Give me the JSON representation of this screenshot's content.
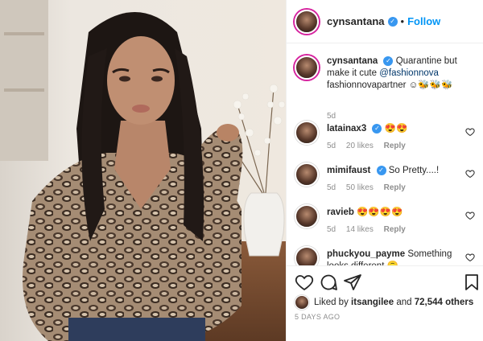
{
  "post": {
    "username": "cynsantana",
    "follow_label": "Follow",
    "separator": "•"
  },
  "caption": {
    "username": "cynsantana",
    "text_before": "Quarantine but make it cute ",
    "mention": "@fashionnova",
    "text_after": " fashionnovapartner ☺🐝🐝🐝",
    "time": "5d"
  },
  "comments": [
    {
      "username": "latainax3",
      "text": "😍😍",
      "time": "5d",
      "likes": "20 likes",
      "reply": "Reply"
    },
    {
      "username": "mimifaust",
      "text": "So Pretty....!",
      "time": "5d",
      "likes": "50 likes",
      "reply": "Reply"
    },
    {
      "username": "ravieb",
      "text": "😍😍😍😍",
      "time": "5d",
      "likes": "14 likes",
      "reply": "Reply"
    },
    {
      "username": "phuckyou_payme",
      "text": "Something looks different 🙃",
      "time": "",
      "likes": "",
      "reply": ""
    }
  ],
  "likes": {
    "prefix": "Liked by",
    "user": "itsangilee",
    "connector": "and",
    "count": "72,544 others"
  },
  "timestamp": "5 DAYS AGO",
  "icons": {
    "like": "heart-icon",
    "comment": "comment-icon",
    "share": "share-icon",
    "save": "bookmark-icon",
    "verified": "verified-badge-icon"
  },
  "colors": {
    "link": "#0095f6",
    "verified": "#3897f0",
    "meta": "#8e8e8e",
    "text": "#262626"
  }
}
